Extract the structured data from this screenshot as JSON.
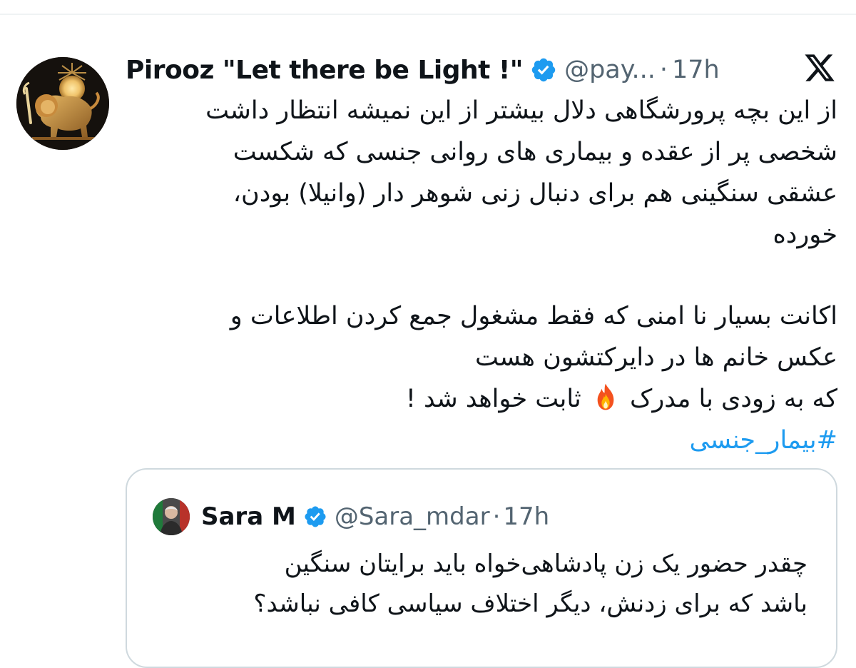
{
  "tweet": {
    "author": {
      "display_name": "Pirooz \"Let there be Light !\"",
      "handle": "@pay...",
      "verified": true,
      "avatar_icon": "lion-and-sun-icon"
    },
    "separator": "·",
    "time": "17h",
    "brand_icon": "x-logo-icon",
    "body_lines": [
      "از این بچه پرورشگاهی دلال بیشتر از این نمیشه انتظار داشت",
      "شخصی پر از عقده و بیماری های روانی جنسی که شکست",
      "عشقی سنگینی هم برای دنبال زنی شوهر دار (وانیلا) بودن،",
      "خورده",
      "اکانت بسیار نا امنی که فقط مشغول جمع کردن اطلاعات و",
      "عکس خانم ها در دایرکتشون هست"
    ],
    "last_line_start": "که به زودی با مدرک",
    "last_line_emoji": "fire-emoji-icon",
    "last_line_end": "ثابت خواهد شد !",
    "hashtag": "#بیمار_جنسی"
  },
  "quoted_tweet": {
    "author": {
      "display_name": "Sara M",
      "handle": "@Sara_mdar",
      "verified": true,
      "avatar_icon": "user-avatar"
    },
    "separator": "·",
    "time": "17h",
    "body_lines": [
      "چقدر حضور یک زن پادشاهی‌خواه باید برایتان سنگین",
      "باشد که برای زدنش، دیگر اختلاف سیاسی کافی نباشد؟"
    ]
  },
  "colors": {
    "text": "#0f1419",
    "secondary": "#536471",
    "link": "#1d9bf0",
    "verified": "#1d9bf0",
    "border": "#cfd9de"
  }
}
